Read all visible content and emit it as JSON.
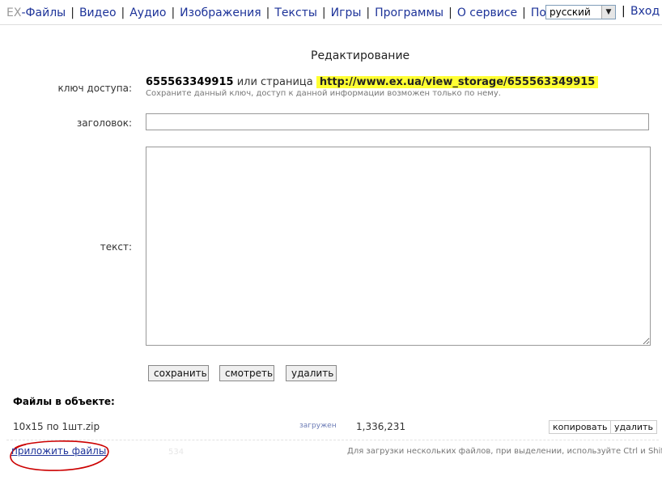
{
  "nav": {
    "logo_prefix": "EX",
    "items": [
      "-Файлы",
      "Видео",
      "Аудио",
      "Изображения",
      "Тексты",
      "Игры",
      "Программы",
      "О сервисе",
      "Поиск"
    ],
    "separator": "|",
    "language": "русский",
    "login": "Вход"
  },
  "page": {
    "title": "Редактирование"
  },
  "form": {
    "access_key_label": "ключ доступа:",
    "access_key": "655563349915",
    "or_page": "или страница",
    "storage_url": "http://www.ex.ua/view_storage/655563349915",
    "hint": "Сохраните данный ключ, доступ к данной информации возможен только по нему.",
    "title_label": "заголовок:",
    "title_value": "",
    "text_label": "текст:",
    "text_value": "",
    "buttons": {
      "save": "сохранить",
      "view": "смотреть",
      "delete": "удалить"
    }
  },
  "files": {
    "header": "Файлы в объекте:",
    "items": [
      {
        "name": "10x15 по 1шт.zip",
        "status": "загружен",
        "size": "1,336,231",
        "copy": "копировать",
        "delete": "удалить"
      }
    ],
    "attach_link": "приложить файлы",
    "faint_text": "534",
    "upload_hint": "Для загрузки нескольких файлов, при выделении, используйте Ctrl и Shift."
  },
  "colors": {
    "link": "#1d3399",
    "highlight": "#ffff33",
    "circle": "#cc0000"
  }
}
